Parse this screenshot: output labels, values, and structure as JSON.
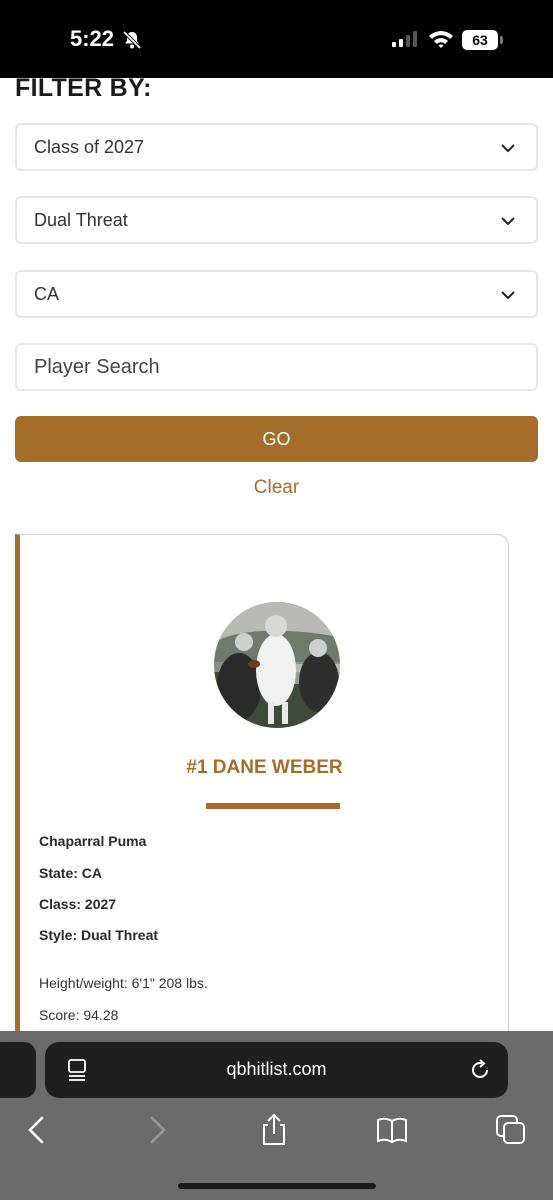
{
  "status_bar": {
    "time": "5:22",
    "battery": "63",
    "icons": [
      "bell-slash-icon",
      "signal-icon",
      "wifi-icon",
      "battery-icon"
    ]
  },
  "filters": {
    "title": "FILTER BY:",
    "class_select": "Class of 2027",
    "style_select": "Dual Threat",
    "state_select": "CA",
    "search_placeholder": "Player Search",
    "go_label": "GO",
    "clear_label": "Clear"
  },
  "player_card": {
    "name": "#1 DANE WEBER",
    "school": "Chaparral Puma",
    "state": "State: CA",
    "class": "Class: 2027",
    "style": "Style: Dual Threat",
    "height_weight": "Height/weight: 6'1\" 208 lbs.",
    "score": "Score: 94.28"
  },
  "browser": {
    "url": "qbhitlist.com",
    "icons": [
      "reader-icon",
      "reload-icon",
      "back-icon",
      "forward-icon",
      "share-icon",
      "bookmarks-icon",
      "tabs-icon"
    ]
  },
  "colors": {
    "accent": "#a56d2a",
    "status_bar": "#000000",
    "browser_bar": "#6b6b6b",
    "url_pill": "#1f1f1f"
  }
}
